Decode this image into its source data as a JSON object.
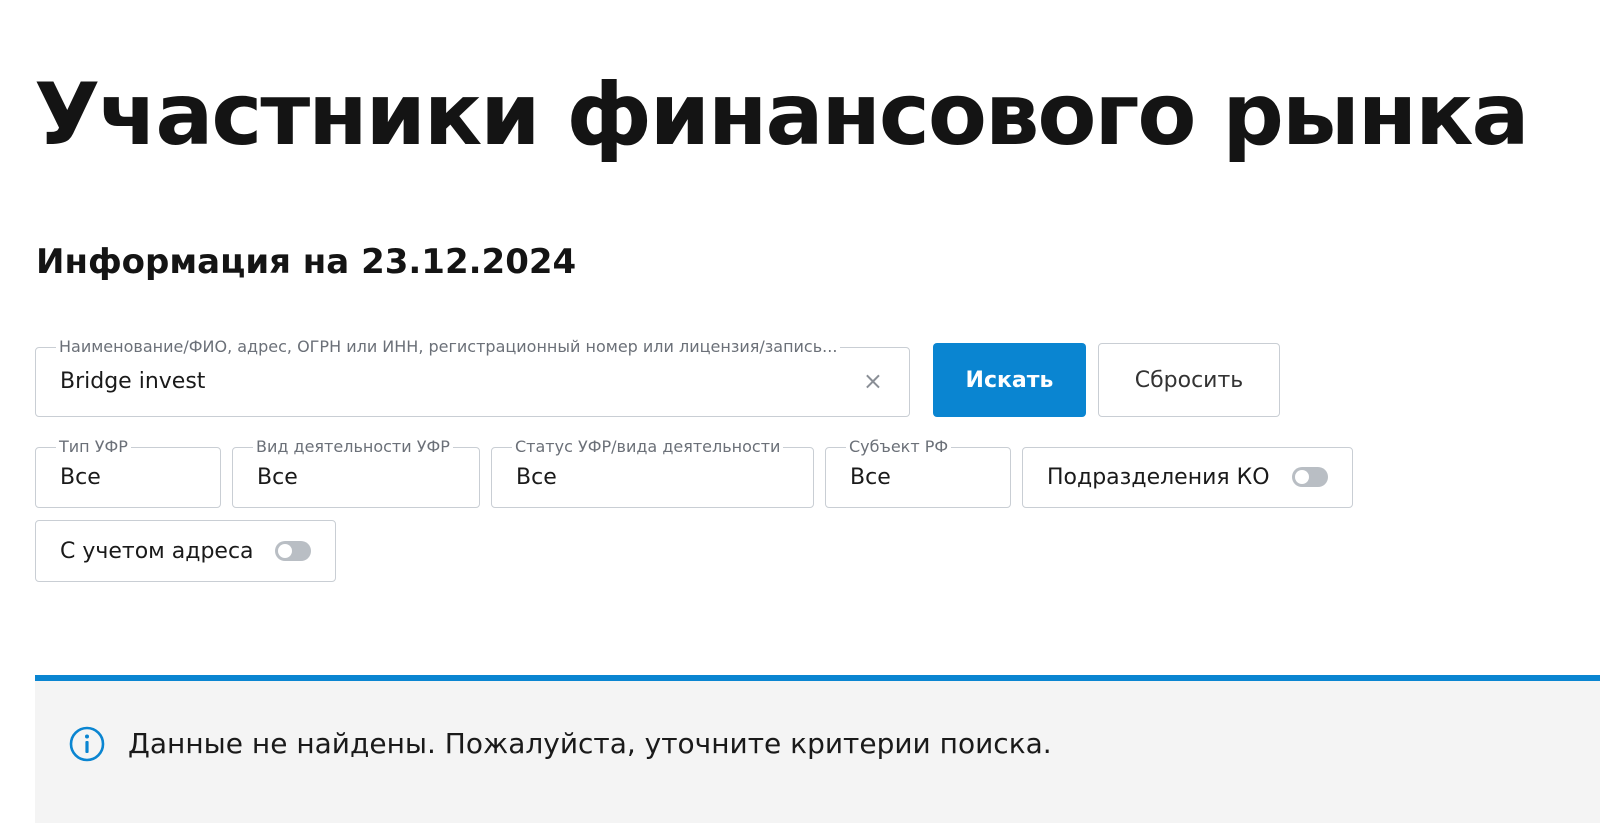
{
  "page": {
    "title": "Участники финансового рынка",
    "info_date": "Информация на 23.12.2024"
  },
  "search": {
    "label": "Наименование/ФИО, адрес, ОГРН или ИНН, регистрационный номер или лицензия/запись...",
    "value": "Bridge invest",
    "clear_icon": "×",
    "search_button": "Искать",
    "reset_button": "Сбросить"
  },
  "filters": {
    "type": {
      "label": "Тип УФР",
      "value": "Все"
    },
    "activity": {
      "label": "Вид деятельности УФР",
      "value": "Все"
    },
    "status": {
      "label": "Статус УФР/вида деятельности",
      "value": "Все"
    },
    "region": {
      "label": "Субъект РФ",
      "value": "Все"
    },
    "branches_toggle": {
      "label": "Подразделения КО",
      "on": false
    },
    "address_toggle": {
      "label": "С учетом адреса",
      "on": false
    }
  },
  "notice": {
    "text": "Данные не найдены. Пожалуйста, уточните критерии поиска.",
    "icon": "info-icon"
  },
  "colors": {
    "accent": "#0a85d1",
    "text": "#141414",
    "border": "#c9ced4",
    "notice_bg": "#f4f4f4"
  }
}
